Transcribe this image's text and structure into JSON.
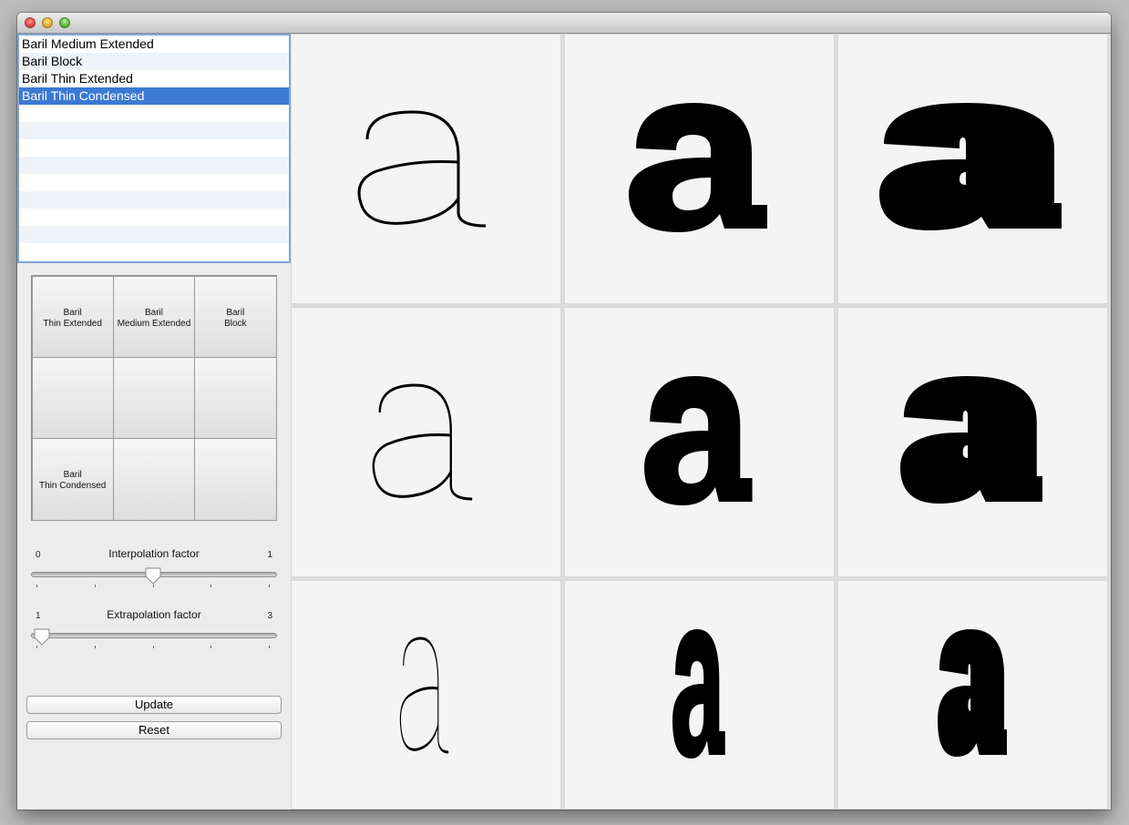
{
  "window": {
    "controls": [
      "close-icon",
      "minimize-icon",
      "zoom-icon"
    ]
  },
  "font_list": {
    "items": [
      {
        "label": "Baril Medium Extended",
        "selected": false
      },
      {
        "label": "Baril Block",
        "selected": false
      },
      {
        "label": "Baril Thin Extended",
        "selected": false
      },
      {
        "label": "Baril Thin Condensed",
        "selected": true
      }
    ],
    "selection_color": "#3b79d4"
  },
  "master_grid": {
    "cells": [
      {
        "line1": "Baril",
        "line2": "Thin Extended"
      },
      {
        "line1": "Baril",
        "line2": "Medium Extended"
      },
      {
        "line1": "Baril",
        "line2": "Block"
      },
      {
        "line1": "",
        "line2": ""
      },
      {
        "line1": "",
        "line2": ""
      },
      {
        "line1": "",
        "line2": ""
      },
      {
        "line1": "Baril",
        "line2": "Thin Condensed"
      },
      {
        "line1": "",
        "line2": ""
      },
      {
        "line1": "",
        "line2": ""
      }
    ]
  },
  "interpolation": {
    "label": "Interpolation factor",
    "min_label": "0",
    "max_label": "1",
    "min": 0,
    "max": 1,
    "value": 0.5
  },
  "extrapolation": {
    "label": "Extrapolation factor",
    "min_label": "1",
    "max_label": "3",
    "min": 1,
    "max": 3,
    "value": 1.05
  },
  "buttons": {
    "update": "Update",
    "reset": "Reset"
  },
  "preview": {
    "glyph": "a",
    "cells": [
      {
        "weight": "thin",
        "width": "extended"
      },
      {
        "weight": "medium",
        "width": "extended"
      },
      {
        "weight": "block",
        "width": "extended"
      },
      {
        "weight": "thin",
        "width": "normal"
      },
      {
        "weight": "medium",
        "width": "normal"
      },
      {
        "weight": "block",
        "width": "normal"
      },
      {
        "weight": "thin",
        "width": "condensed"
      },
      {
        "weight": "medium",
        "width": "condensed"
      },
      {
        "weight": "block",
        "width": "condensed"
      }
    ]
  }
}
